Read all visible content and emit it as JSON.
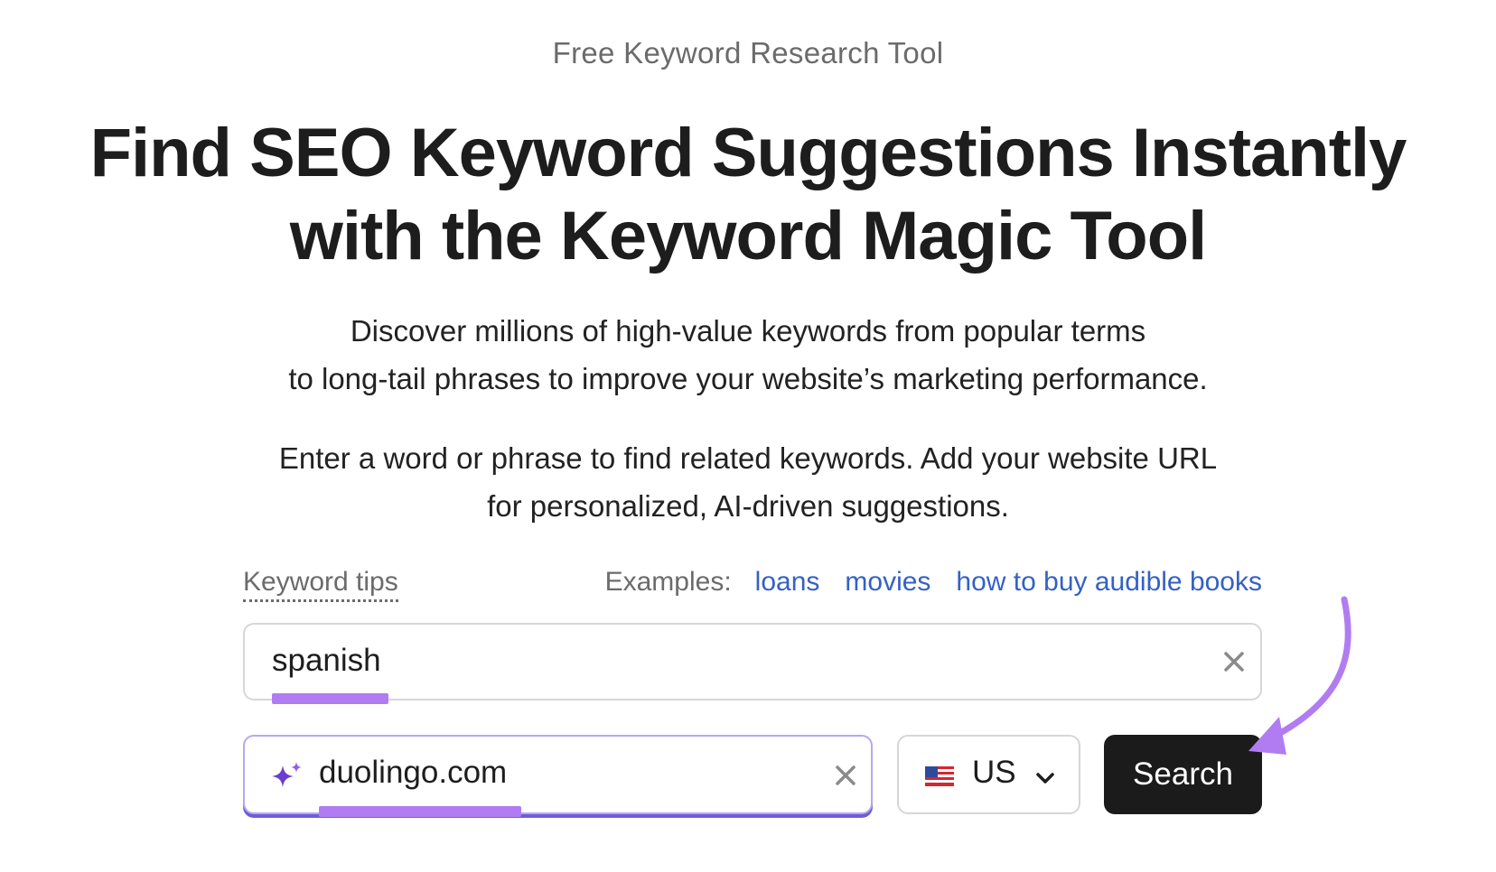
{
  "header": {
    "eyebrow": "Free Keyword Research Tool",
    "headline_line1": "Find SEO Keyword Suggestions Instantly",
    "headline_line2": "with the Keyword Magic Tool"
  },
  "description": {
    "line1": "Discover millions of high-value keywords from popular terms",
    "line2": "to long-tail phrases to improve your website’s marketing performance."
  },
  "prompt": {
    "line1": "Enter a word or phrase to find related keywords. Add your website URL",
    "line2": "for personalized, AI-driven suggestions."
  },
  "tips": {
    "label": "Keyword tips",
    "examples_label": "Examples:",
    "examples": [
      "loans",
      "movies",
      "how to buy audible books"
    ]
  },
  "form": {
    "keyword_value": "spanish",
    "domain_value": "duolingo.com",
    "country": "US",
    "country_flag": "us-flag-icon",
    "search_label": "Search"
  },
  "colors": {
    "highlight": "#b17cf2",
    "link": "#3461c4",
    "button_bg": "#1b1b1b",
    "sparkle": "#6a3fd0"
  }
}
